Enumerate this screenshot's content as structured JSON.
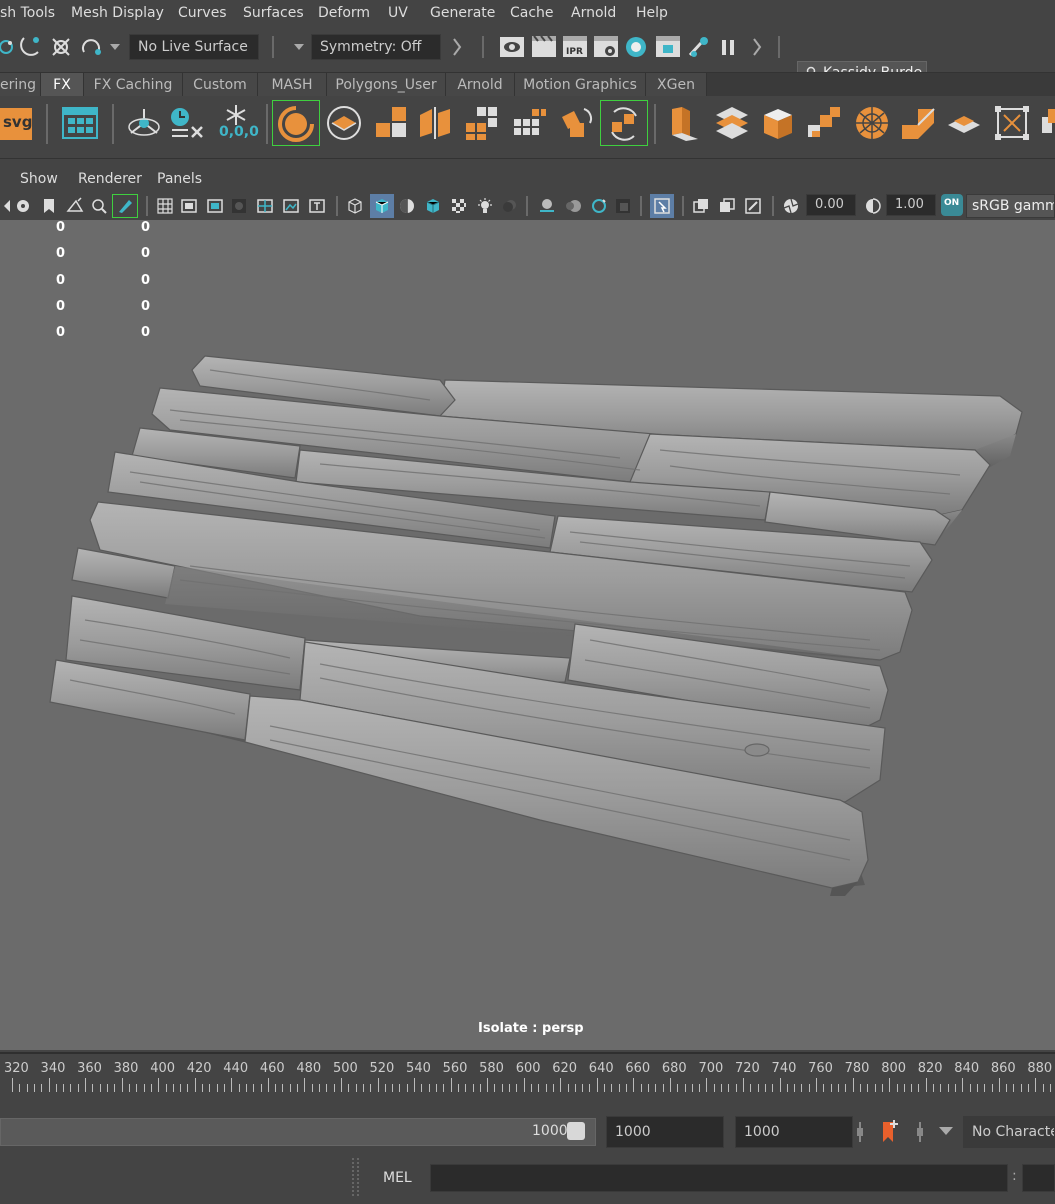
{
  "menubar": {
    "items": [
      "sh Tools",
      "Mesh Display",
      "Curves",
      "Surfaces",
      "Deform",
      "UV",
      "Generate",
      "Cache",
      "Arnold",
      "Help"
    ]
  },
  "statusline": {
    "live_surface": "No Live Surface",
    "symmetry": "Symmetry: Off",
    "user": "Kassidy Burde"
  },
  "shelf_tabs": {
    "items": [
      "ering",
      "FX",
      "FX Caching",
      "Custom",
      "MASH",
      "Polygons_User",
      "Arnold",
      "Motion Graphics",
      "XGen"
    ],
    "active": "FX"
  },
  "shelf": {
    "svg_label": "svg",
    "snowflake_label": "0,0,0"
  },
  "panel_menu": {
    "items": [
      "Show",
      "Renderer",
      "Panels"
    ]
  },
  "panel_toolbar": {
    "exposure": "0.00",
    "gamma": "1.00",
    "colorspace_toggle": "ON",
    "colorspace": "sRGB gamma"
  },
  "viewport": {
    "hud_rows": [
      [
        "0",
        "0"
      ],
      [
        "0",
        "0"
      ],
      [
        "0",
        "0"
      ],
      [
        "0",
        "0"
      ],
      [
        "0",
        "0"
      ]
    ],
    "isolate_label": "Isolate : persp"
  },
  "timeline": {
    "ticks": [
      "320",
      "340",
      "360",
      "380",
      "400",
      "420",
      "440",
      "460",
      "480",
      "500",
      "520",
      "540",
      "560",
      "580",
      "600",
      "620",
      "640",
      "660",
      "680",
      "700",
      "720",
      "740",
      "760",
      "780",
      "800",
      "820",
      "840",
      "860",
      "880"
    ]
  },
  "range": {
    "slider_end": "1000",
    "anim_end": "1000",
    "anim_end2": "1000",
    "character_set": "No Character"
  },
  "command": {
    "language": "MEL"
  },
  "colors": {
    "accent_orange": "#e8913c",
    "accent_teal": "#3fb6c8",
    "viewport_bg": "#6b6b6b",
    "ui_bg": "#444444"
  }
}
